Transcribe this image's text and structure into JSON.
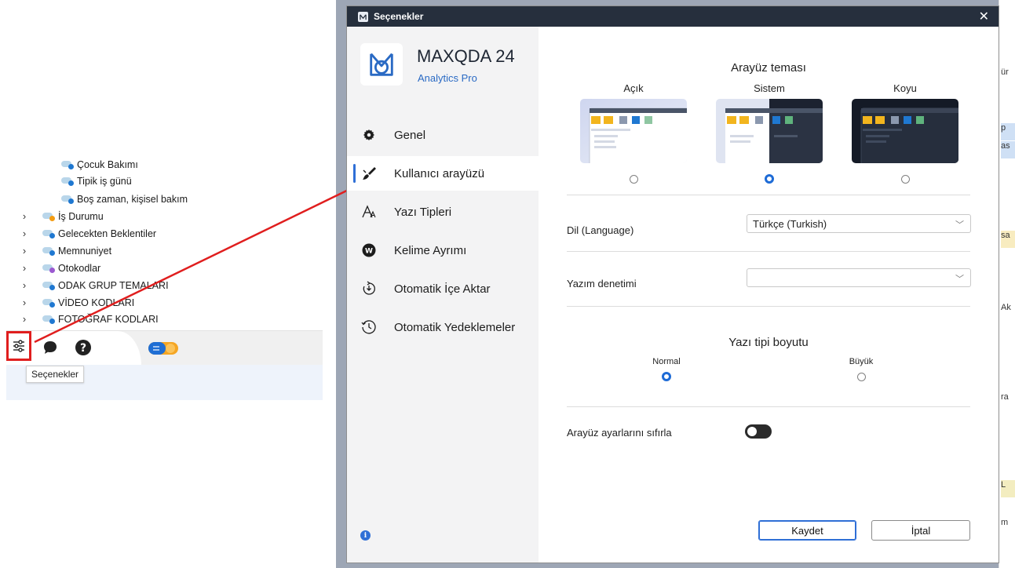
{
  "tree": {
    "items": [
      {
        "label": "Çocuk Bakımı",
        "has_children": false,
        "dot": "#1f78d1"
      },
      {
        "label": "Tipik iş günü",
        "has_children": false,
        "dot": "#1f78d1"
      },
      {
        "label": "Boş zaman, kişisel bakım",
        "has_children": false,
        "dot": "#1f78d1"
      },
      {
        "label": "İş Durumu",
        "has_children": true,
        "dot": "#f39c12"
      },
      {
        "label": "Gelecekten Beklentiler",
        "has_children": true,
        "dot": "#1f78d1"
      },
      {
        "label": "Memnuniyet",
        "has_children": true,
        "dot": "#1f78d1"
      },
      {
        "label": "Otokodlar",
        "has_children": true,
        "dot": "#9b59d0"
      },
      {
        "label": "ODAK GRUP TEMALARI",
        "has_children": true,
        "dot": "#1f78d1"
      },
      {
        "label": "VİDEO KODLARI",
        "has_children": true,
        "dot": "#1f78d1"
      },
      {
        "label": "FOTOĞRAF KODLARI",
        "has_children": true,
        "dot": "#1f78d1"
      }
    ],
    "chevron": "›"
  },
  "toolbar": {
    "tooltip": "Seçenekler",
    "icons": [
      "settings-sliders-icon",
      "chat-bubble-icon",
      "help-icon",
      "toggle-switch-icon"
    ]
  },
  "dialog": {
    "title": "Seçenekler",
    "close_label": "✕",
    "product": "MAXQDA 24",
    "edition": "Analytics Pro",
    "nav": [
      {
        "label": "Genel",
        "icon": "gear-icon",
        "active": false
      },
      {
        "label": "Kullanıcı arayüzü",
        "icon": "paintbrush-icon",
        "active": true
      },
      {
        "label": "Yazı Tipleri",
        "icon": "font-icon",
        "active": false
      },
      {
        "label": "Kelime Ayrımı",
        "icon": "word-split-icon",
        "active": false
      },
      {
        "label": "Otomatik İçe Aktar",
        "icon": "auto-import-icon",
        "active": false
      },
      {
        "label": "Otomatik Yedeklemeler",
        "icon": "backup-clock-icon",
        "active": false
      }
    ],
    "theme": {
      "title": "Arayüz teması",
      "options": [
        {
          "label": "Açık",
          "selected": false
        },
        {
          "label": "Sistem",
          "selected": true
        },
        {
          "label": "Koyu",
          "selected": false
        }
      ]
    },
    "language": {
      "label": "Dil (Language)",
      "value": "Türkçe (Turkish)"
    },
    "spellcheck": {
      "label": "Yazım denetimi",
      "value": ""
    },
    "font_size": {
      "title": "Yazı tipi boyutu",
      "options": [
        {
          "label": "Normal",
          "selected": true
        },
        {
          "label": "Büyük",
          "selected": false
        }
      ]
    },
    "reset": {
      "label": "Arayüz ayarlarını sıfırla",
      "enabled": false
    },
    "buttons": {
      "save": "Kaydet",
      "cancel": "İptal"
    },
    "caret": "﹀"
  },
  "background_strip": [
    "ür",
    "p",
    "as",
    "sa",
    "Ak",
    "ra",
    "L",
    "m"
  ],
  "colors": {
    "accent": "#2f6fd6",
    "titlebar": "#262f3d",
    "highlight_red": "#e01e1e"
  }
}
